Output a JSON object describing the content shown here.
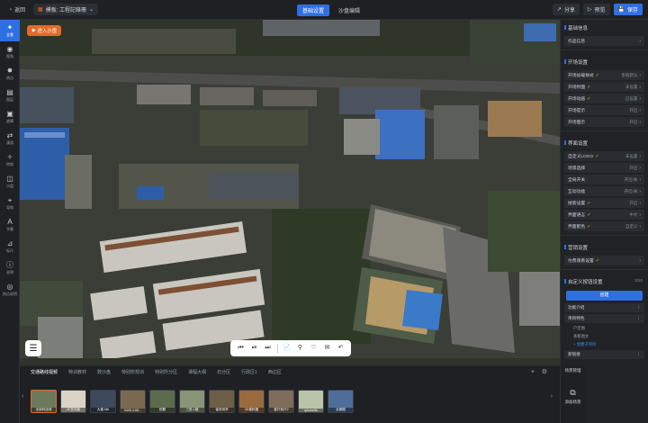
{
  "topbar": {
    "back_label": "返回",
    "template_label": "模板: 工程記錄冊",
    "modes": [
      {
        "label": "基础设置",
        "active": true
      },
      {
        "label": "沙盘编辑",
        "active": false
      }
    ],
    "share_label": "分享",
    "preview_label": "预览",
    "save_label": "保存"
  },
  "leftbar": [
    {
      "label": "全景",
      "icon": "panorama-icon",
      "active": true
    },
    {
      "label": "视角",
      "icon": "eye-icon"
    },
    {
      "label": "热点",
      "icon": "hotspot-icon"
    },
    {
      "label": "图层",
      "icon": "layers-icon"
    },
    {
      "label": "遮罩",
      "icon": "mask-icon"
    },
    {
      "label": "漫游",
      "icon": "roam-icon"
    },
    {
      "label": "特效",
      "icon": "effects-icon"
    },
    {
      "label": "沙盘",
      "icon": "sandbox-icon"
    },
    {
      "label": "导航",
      "icon": "location-icon"
    },
    {
      "label": "字幕",
      "icon": "text-icon"
    },
    {
      "label": "标尺",
      "icon": "ruler-icon"
    },
    {
      "label": "说明",
      "icon": "info-icon"
    },
    {
      "label": "热点说明",
      "icon": "hotspot-info-icon"
    }
  ],
  "viewport": {
    "enter_tag": "进入沙盘",
    "tools": [
      "prev-icon",
      "play-icon",
      "next-icon",
      "doc-icon",
      "search-icon",
      "heart-icon",
      "comment-icon",
      "share-icon"
    ]
  },
  "bottom": {
    "categories": [
      {
        "label": "交通路线视频",
        "active": true
      },
      {
        "label": "特训教材"
      },
      {
        "label": "数沙盘"
      },
      {
        "label": "特别所规训"
      },
      {
        "label": "特别所分区"
      },
      {
        "label": "课程大纲"
      },
      {
        "label": "石分区"
      },
      {
        "label": "行政区1"
      },
      {
        "label": "西边区"
      }
    ],
    "thumbnails": [
      {
        "caption": "全新科技城",
        "color": "#6b7a5d",
        "selected": true
      },
      {
        "caption": "1F总平面",
        "color": "#d9d4c6"
      },
      {
        "caption": "大楼-Mb",
        "color": "#3d4a5c"
      },
      {
        "caption": "0405-4-68...",
        "color": "#7a6a4f"
      },
      {
        "caption": "别墅",
        "color": "#5c6b4d"
      },
      {
        "caption": "三阶-1楼",
        "color": "#8a9477"
      },
      {
        "caption": "保安岗亭",
        "color": "#6d5e48"
      },
      {
        "caption": "3D楼栋图",
        "color": "#9a6a3e"
      },
      {
        "caption": "客厅前厅2",
        "color": "#7d6d5a"
      },
      {
        "caption": "iphone5s",
        "color": "#b9c4a8"
      },
      {
        "caption": "全景图",
        "color": "#4f6d9a"
      }
    ],
    "scene_mgmt": "场景管理",
    "add_scene": "添加场景"
  },
  "rightpanel": {
    "sections": [
      {
        "title": "基础信息",
        "rows": [
          {
            "label": "作品信息",
            "value": "",
            "check": false
          }
        ]
      },
      {
        "title": "开场设置",
        "rows": [
          {
            "label": "开场加载样式",
            "value": "系统默认",
            "check": true
          },
          {
            "label": "开场封面",
            "value": "未设置",
            "check": true
          },
          {
            "label": "开场动画",
            "value": "已设置",
            "check": true
          },
          {
            "label": "开场提示",
            "value": "开启",
            "check": false
          },
          {
            "label": "开场图示",
            "value": "开启",
            "check": false
          }
        ]
      },
      {
        "title": "界面设置",
        "rows": [
          {
            "label": "自定义LOGO",
            "value": "未设置",
            "check": true
          },
          {
            "label": "场景选择",
            "value": "开启",
            "check": false
          },
          {
            "label": "全局开关",
            "value": "开启/关",
            "check": false
          },
          {
            "label": "互动功能",
            "value": "开启/关",
            "check": false
          },
          {
            "label": "搜索设置",
            "value": "开启",
            "check": true
          },
          {
            "label": "界面语言",
            "value": "中文",
            "check": true
          },
          {
            "label": "界面配色",
            "value": "自定义",
            "check": true
          }
        ]
      },
      {
        "title": "营销设置",
        "rows": [
          {
            "label": "付费观看设置",
            "value": "",
            "check": true
          }
        ]
      }
    ],
    "custom_title": "自定义按钮设置",
    "custom_counter": "3/10",
    "create_label": "创建",
    "groups": [
      {
        "label": "功能介绍"
      },
      {
        "label": "项目特色",
        "subs": [
          {
            "label": "户型图"
          },
          {
            "label": "查看图文"
          },
          {
            "label": "+ 创建子项目",
            "link": true
          }
        ]
      },
      {
        "label": "新链接"
      }
    ]
  }
}
